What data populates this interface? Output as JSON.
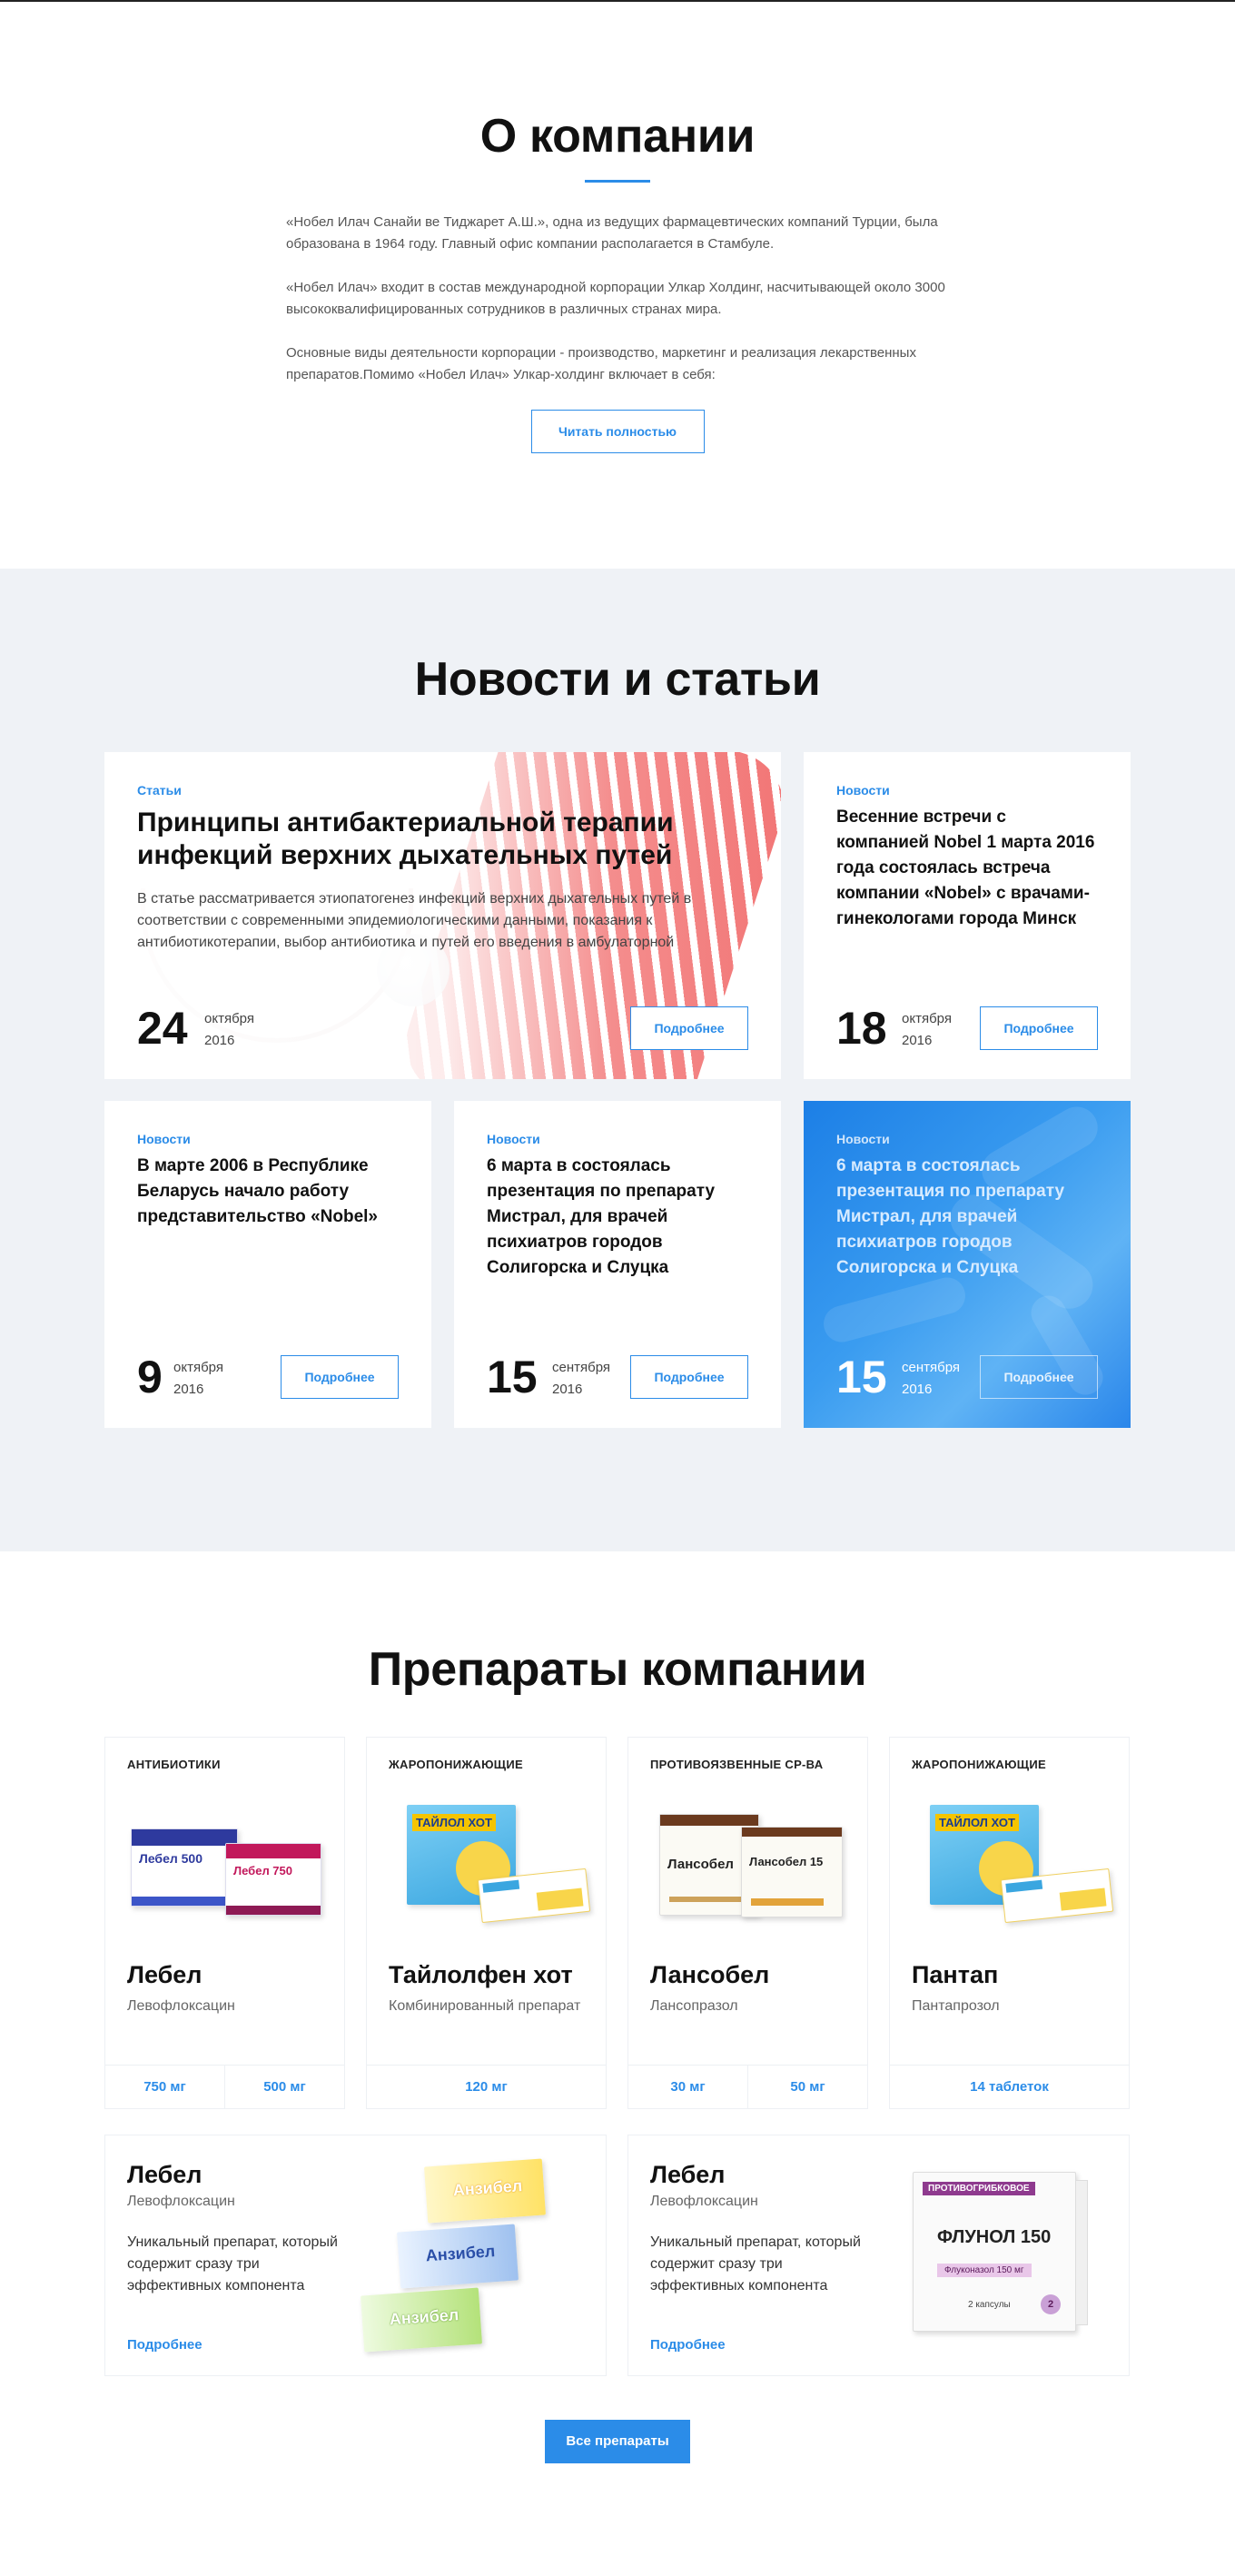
{
  "about": {
    "title": "О компании",
    "paragraphs": [
      "«Нобел Илач Санайи ве Тиджарет А.Ш.», одна из ведущих фармацевтических компаний Турции, была образована в 1964 году. Главный офис компании располагается в Стамбуле.",
      "«Нобел Илач» входит в состав международной корпорации Улкар Холдинг, насчитывающей около 3000 высококвалифицированных сотрудников в различных странах мира.",
      "Основные виды деятельности корпорации - производство, маркетинг и реализация лекарственных препаратов.Помимо «Нобел Илач» Улкар-холдинг включает в себя:"
    ],
    "read_more": "Читать полностью"
  },
  "news": {
    "title": "Новости и статьи",
    "more_label": "Подробнее",
    "items": [
      {
        "category": "Статьи",
        "title": "Принципы антибактериальной терапии инфекций верхних дыхательных путей",
        "description": "В статье рассматривается этиопатогенез инфекций верхних дыхательных путей в соответствии с современными эпидемиологическими данными, показания к антибиотикотерапии, выбор антибиотика и путей его введения в амбулаторной",
        "day": "24",
        "month": "октября",
        "year": "2016"
      },
      {
        "category": "Новости",
        "title": "Весенние встречи с компанией Nobel 1 марта 2016 года состоялась встреча компании «Nobel» с врачами-гинекологами города Минск",
        "day": "18",
        "month": "октября",
        "year": "2016"
      },
      {
        "category": "Новости",
        "title": "В марте 2006 в Республике Беларусь начало работу представительство «Nobel»",
        "day": "9",
        "month": "октября",
        "year": "2016"
      },
      {
        "category": "Новости",
        "title": "6 марта в состоялась презентация по препарату Мистрал, для врачей психиатров городов Солигорска и Слуцка",
        "day": "15",
        "month": "сентября",
        "year": "2016"
      },
      {
        "category": "Новости",
        "title": "6 марта в состоялась презентация по препарату Мистрал, для врачей психиатров городов Солигорска и Слуцка",
        "day": "15",
        "month": "сентября",
        "year": "2016"
      }
    ]
  },
  "products": {
    "title": "Препараты компании",
    "cards": [
      {
        "category": "АНТИБИОТИКИ",
        "name": "Лебел",
        "substance": "Левофлоксацин",
        "doses": [
          "750 мг",
          "500 мг"
        ],
        "box_labels": [
          "Лебел 500",
          "Лебел 750"
        ]
      },
      {
        "category": "ЖАРОПОНИЖАЮЩИЕ",
        "name": "Тайлолфен хот",
        "substance": "Комбинированный препарат",
        "doses": [
          "120 мг"
        ],
        "box_labels": [
          "ТАЙЛОЛ ХОТ"
        ]
      },
      {
        "category": "ПРОТИВОЯЗВЕННЫЕ СР-ВА",
        "name": "Лансобел",
        "substance": "Лансопразол",
        "doses": [
          "30 мг",
          "50 мг"
        ],
        "box_labels": [
          "Лансобел",
          "Лансобел 15"
        ]
      },
      {
        "category": "ЖАРОПОНИЖАЮЩИЕ",
        "name": "Пантап",
        "substance": "Пантапрозол",
        "doses": [
          "14 таблеток"
        ],
        "box_labels": [
          "ТАЙЛОЛ ХОТ"
        ]
      }
    ],
    "wide_cards": [
      {
        "name": "Лебел",
        "substance": "Левофлоксацин",
        "description": "Уникальный препарат, который содержит сразу три эффективных компонента",
        "link": "Подробнее",
        "box_labels": [
          "Анзибел",
          "Анзибел",
          "Анзибел"
        ]
      },
      {
        "name": "Лебел",
        "substance": "Левофлоксацин",
        "description": "Уникальный препарат, который содержит сразу три эффективных компонента",
        "link": "Подробнее",
        "box_labels": [
          "ПРОТИВОГРИБКОВОЕ",
          "ФЛУНОЛ 150",
          "Флуконазол 150 мг",
          "2 капсулы",
          "2"
        ]
      }
    ],
    "all_button": "Все препараты"
  }
}
